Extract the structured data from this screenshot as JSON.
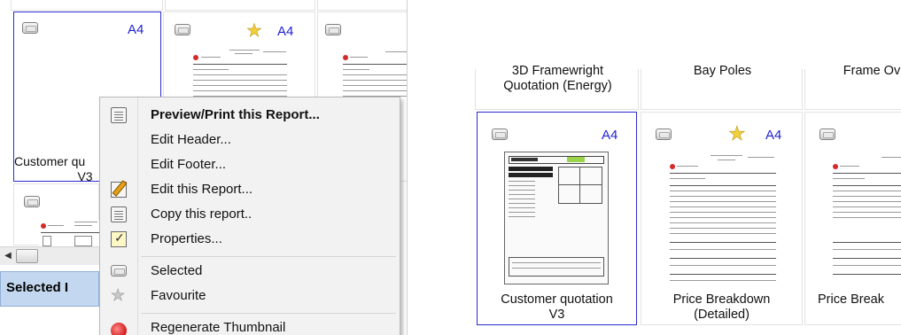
{
  "left": {
    "tile1": {
      "paper": "A4",
      "label_line1": "Customer qu",
      "label_line2": "V3"
    },
    "tile2": {
      "paper": "A4"
    },
    "context_menu": [
      {
        "label": "Preview/Print this Report...",
        "icon": "preview-icon",
        "bold": true
      },
      {
        "label": "Edit Header...",
        "icon": "",
        "bold": false
      },
      {
        "label": "Edit Footer...",
        "icon": "",
        "bold": false
      },
      {
        "label": "Edit this Report...",
        "icon": "edit-pencil-icon",
        "bold": false
      },
      {
        "label": "Copy this report..",
        "icon": "copy-icon",
        "bold": false
      },
      {
        "label": "Properties...",
        "icon": "properties-icon",
        "bold": false
      },
      {
        "label": "Selected",
        "icon": "selected-icon",
        "bold": false
      },
      {
        "label": "Favourite",
        "icon": "star-icon",
        "bold": false
      },
      {
        "label": "Regenerate Thumbnail",
        "icon": "regenerate-icon",
        "bold": false
      }
    ],
    "selected_header": "Selected I"
  },
  "right": {
    "top_labels": [
      "3D Framewright",
      "Quotation (Energy)",
      "Bay Poles",
      "Frame Ov"
    ],
    "tiles": [
      {
        "paper": "A4",
        "label_line1": "Customer quotation",
        "label_line2": "V3",
        "favourite": false,
        "selected": true
      },
      {
        "paper": "A4",
        "label_line1": "Price Breakdown",
        "label_line2": "(Detailed)",
        "favourite": true,
        "selected": false
      },
      {
        "paper": "",
        "label_line1": "Price Break",
        "label_line2": "",
        "favourite": false,
        "selected": false
      }
    ]
  },
  "colors": {
    "selection_border": "#2b2bd0",
    "paper_size_text": "#1f1fd6",
    "star": "#f2cf3b",
    "header_bg": "#c3d8f0"
  }
}
